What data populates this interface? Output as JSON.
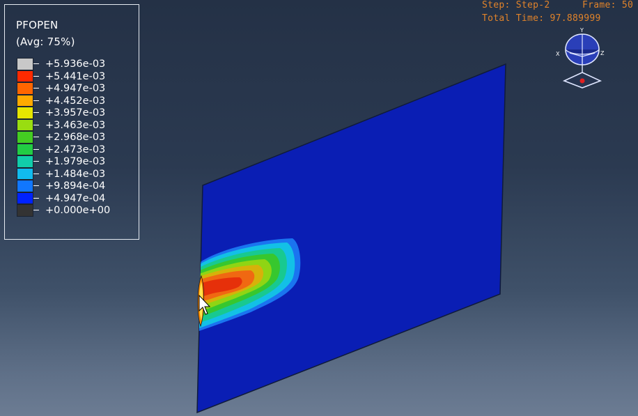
{
  "legend": {
    "variable": "PFOPEN",
    "averaging": "(Avg: 75%)",
    "levels": [
      {
        "label": "+5.936e-03",
        "color": "#c8c8c8"
      },
      {
        "label": "+5.441e-03",
        "color": "#ff2a00"
      },
      {
        "label": "+4.947e-03",
        "color": "#ff6600"
      },
      {
        "label": "+4.452e-03",
        "color": "#ffaa00"
      },
      {
        "label": "+3.957e-03",
        "color": "#e6e600"
      },
      {
        "label": "+3.463e-03",
        "color": "#99dd11"
      },
      {
        "label": "+2.968e-03",
        "color": "#44cc22"
      },
      {
        "label": "+2.473e-03",
        "color": "#22cc44"
      },
      {
        "label": "+1.979e-03",
        "color": "#11ccaa"
      },
      {
        "label": "+1.484e-03",
        "color": "#11bbee"
      },
      {
        "label": "+9.894e-04",
        "color": "#1177ff"
      },
      {
        "label": "+4.947e-04",
        "color": "#0022ff"
      },
      {
        "label": "+0.000e+00",
        "color": "#333333"
      }
    ]
  },
  "status": {
    "step": "Step: Step-2",
    "frame": "Frame: 50",
    "total_time": "Total Time: 97.889999"
  },
  "triad": {
    "axis_x": "X",
    "axis_y": "Y",
    "axis_z": "Z"
  },
  "colors": {
    "plate": "#0a1eb4",
    "plate_edge": "#101b3a",
    "status_text": "#e0832a",
    "legend_border": "#e6ebf2"
  },
  "cursor": "arrow-cursor-icon"
}
